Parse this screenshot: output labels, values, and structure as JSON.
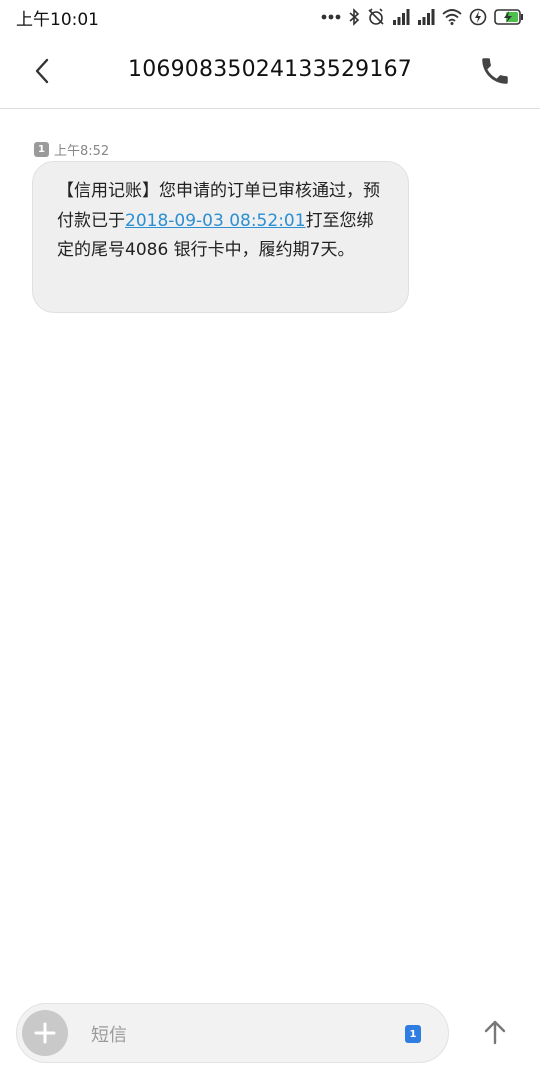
{
  "status_bar": {
    "time": "上午10:01",
    "icons": [
      "more-dots-icon",
      "bluetooth-icon",
      "alarm-off-icon",
      "signal-icon",
      "signal-icon",
      "wifi-icon",
      "data-saver-icon",
      "battery-charging-icon"
    ]
  },
  "header": {
    "back_icon": "chevron-left-icon",
    "title": "10690835024133529167",
    "call_icon": "phone-icon"
  },
  "message": {
    "sim": "1",
    "time": "上午8:52",
    "text_before_link": "【信用记账】您申请的订单已审核通过，预付款已于",
    "link": "2018-09-03 08:52:01",
    "text_after_link": "打至您绑定的尾号4086 银行卡中，履约期7天。"
  },
  "composer": {
    "add_icon": "plus-icon",
    "placeholder": "短信",
    "value": "",
    "sim": "1",
    "send_icon": "arrow-up-icon"
  },
  "colors": {
    "link": "#2a8fd4",
    "bubble": "#efefef",
    "sim_badge": "#2f7de0"
  }
}
